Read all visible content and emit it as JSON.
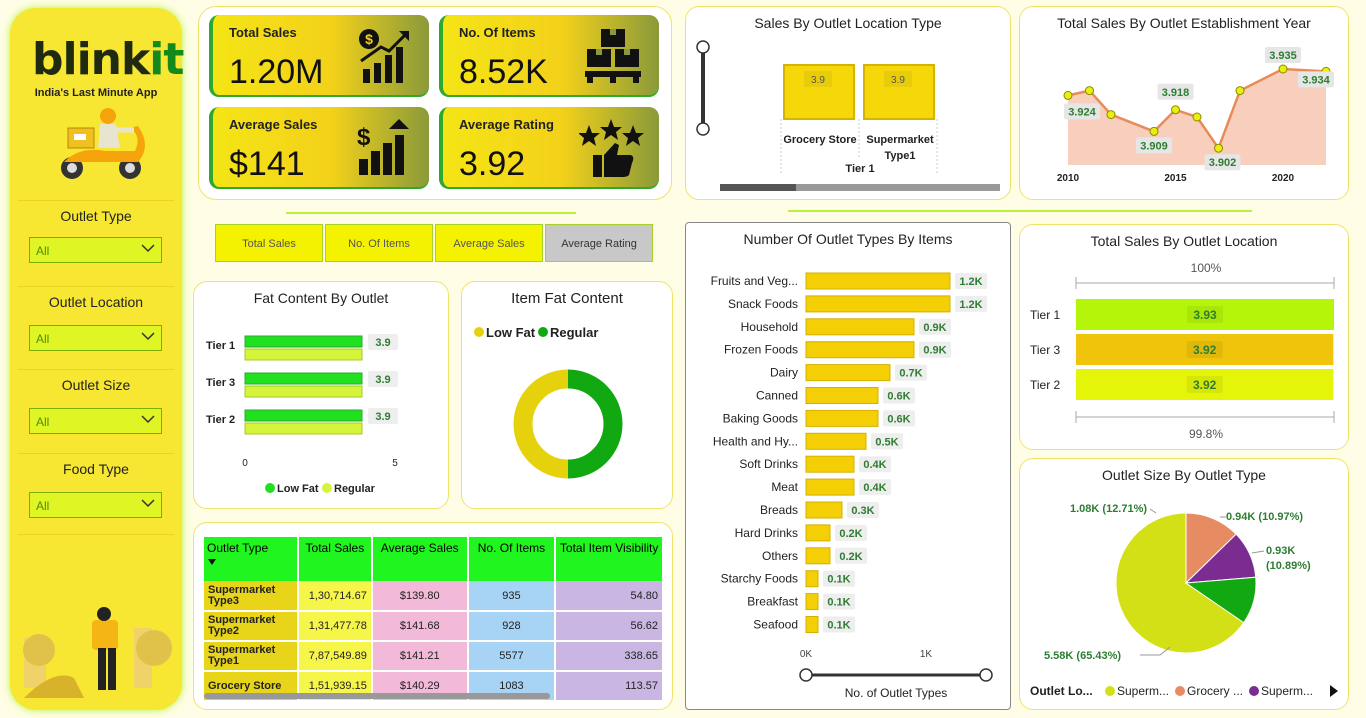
{
  "brand": {
    "name_a": "blink",
    "name_b": "it",
    "tagline": "India's Last Minute App"
  },
  "filters": [
    {
      "label": "Outlet Type",
      "value": "All"
    },
    {
      "label": "Outlet Location",
      "value": "All"
    },
    {
      "label": "Outlet Size",
      "value": "All"
    },
    {
      "label": "Food Type",
      "value": "All"
    }
  ],
  "kpis": [
    {
      "label": "Total Sales",
      "value": "1.20M",
      "icon": "dollar-growth-icon"
    },
    {
      "label": "No. Of Items",
      "value": "8.52K",
      "icon": "boxes-icon"
    },
    {
      "label": "Average Sales",
      "value": "$141",
      "icon": "dollar-bars-icon"
    },
    {
      "label": "Average Rating",
      "value": "3.92",
      "icon": "rating-stars-icon"
    }
  ],
  "metric_buttons": [
    "Total Sales",
    "No. Of Items",
    "Average Sales",
    "Average Rating"
  ],
  "selected_metric": "Average Rating",
  "colors": {
    "accent_yellow": "#f7e632",
    "green": "#20f520",
    "dark_green": "#138a1b",
    "bar_yellow": "#f5cf05",
    "salmon": "#f0a57a",
    "purple": "#7b2c91"
  },
  "table": {
    "headers": [
      "Outlet Type",
      "Total Sales",
      "Average Sales",
      "No. Of Items",
      "Total Item Visibility"
    ],
    "rows": [
      [
        "Supermarket Type3",
        "1,30,714.67",
        "$139.80",
        "935",
        "54.80"
      ],
      [
        "Supermarket Type2",
        "1,31,477.78",
        "$141.68",
        "928",
        "56.62"
      ],
      [
        "Supermarket Type1",
        "7,87,549.89",
        "$141.21",
        "5577",
        "338.65"
      ],
      [
        "Grocery Store",
        "1,51,939.15",
        "$140.29",
        "1083",
        "113.57"
      ]
    ]
  },
  "chart_data": [
    {
      "id": "location-type",
      "type": "bar",
      "title": "Sales By Outlet Location Type",
      "group": "Tier 1",
      "categories": [
        "Grocery Store",
        "Supermarket Type1"
      ],
      "values": [
        3.9,
        3.9
      ],
      "data_labels": [
        "3.9",
        "3.9"
      ]
    },
    {
      "id": "establishment-year",
      "type": "area",
      "title": "Total Sales By Outlet Establishment Year",
      "x": [
        2010,
        2011,
        2012,
        2014,
        2015,
        2016,
        2017,
        2018,
        2020,
        2022
      ],
      "y": [
        3.924,
        3.926,
        3.916,
        3.909,
        3.918,
        3.915,
        3.902,
        3.926,
        3.935,
        3.934
      ],
      "data_labels": [
        {
          "x": 2010,
          "text": "3.924"
        },
        {
          "x": 2014,
          "text": "3.909"
        },
        {
          "x": 2015,
          "text": "3.918"
        },
        {
          "x": 2017,
          "text": "3.902"
        },
        {
          "x": 2020,
          "text": "3.935"
        },
        {
          "x": 2022,
          "text": "3.934"
        }
      ],
      "xticks": [
        2010,
        2015,
        2020
      ]
    },
    {
      "id": "fat-by-outlet",
      "type": "bar",
      "title": "Fat Content By Outlet",
      "categories": [
        "Tier 1",
        "Tier 3",
        "Tier 2"
      ],
      "series": [
        {
          "name": "Low Fat",
          "color": "#20e020",
          "values": [
            3.9,
            3.9,
            3.9
          ]
        },
        {
          "name": "Regular",
          "color": "#d4f53a",
          "values": [
            3.9,
            3.9,
            3.9
          ]
        }
      ],
      "data_labels": [
        "3.9",
        "3.9",
        "3.9"
      ],
      "xticks": [
        "0",
        "5"
      ],
      "xlim": [
        0,
        5
      ]
    },
    {
      "id": "item-fat",
      "type": "pie",
      "title": "Item Fat Content",
      "labels": [
        "Low Fat",
        "Regular"
      ],
      "values": [
        0.5,
        0.5
      ],
      "colors": [
        "#e5d20d",
        "#11a811"
      ]
    },
    {
      "id": "outlet-types-items",
      "type": "bar",
      "title": "Number Of Outlet Types By Items",
      "xlabel": "No. of Outlet Types",
      "categories": [
        "Fruits and Veg...",
        "Snack Foods",
        "Household",
        "Frozen Foods",
        "Dairy",
        "Canned",
        "Baking Goods",
        "Health and Hy...",
        "Soft Drinks",
        "Meat",
        "Breads",
        "Hard Drinks",
        "Others",
        "Starchy Foods",
        "Breakfast",
        "Seafood"
      ],
      "values": [
        1200,
        1200,
        900,
        900,
        700,
        600,
        600,
        500,
        400,
        400,
        300,
        200,
        200,
        100,
        100,
        100
      ],
      "data_labels": [
        "1.2K",
        "1.2K",
        "0.9K",
        "0.9K",
        "0.7K",
        "0.6K",
        "0.6K",
        "0.5K",
        "0.4K",
        "0.4K",
        "0.3K",
        "0.2K",
        "0.2K",
        "0.1K",
        "0.1K",
        "0.1K"
      ],
      "xticks": [
        "0K",
        "1K"
      ]
    },
    {
      "id": "sales-by-location",
      "type": "bar",
      "title": "Total Sales By Outlet Location",
      "categories": [
        "Tier 1",
        "Tier 3",
        "Tier 2"
      ],
      "values": [
        3.93,
        3.92,
        3.92
      ],
      "data_labels": [
        "3.93",
        "3.92",
        "3.92"
      ],
      "colors": [
        "#b4f50a",
        "#efc40a",
        "#e4f50a"
      ],
      "top_label": "100%",
      "bottom_label": "99.8%"
    },
    {
      "id": "outlet-size",
      "type": "pie",
      "title": "Outlet Size By Outlet Type",
      "legend_title": "Outlet Lo...",
      "legend": [
        {
          "label": "Superm...",
          "color": "#d4e016"
        },
        {
          "label": "Grocery ...",
          "color": "#e78c62"
        },
        {
          "label": "Superm...",
          "color": "#7b2c91"
        }
      ],
      "slices": [
        {
          "value": 65.43,
          "text": "5.58K (65.43%)",
          "color": "#d4e016"
        },
        {
          "value": 12.71,
          "text": "1.08K (12.71%)",
          "color": "#e78c62"
        },
        {
          "value": 10.97,
          "text": "0.94K (10.97%)",
          "color": "#7b2c91"
        },
        {
          "value": 10.89,
          "text_a": "0.93K",
          "text_b": "(10.89%)",
          "color": "#11a811"
        }
      ]
    }
  ]
}
